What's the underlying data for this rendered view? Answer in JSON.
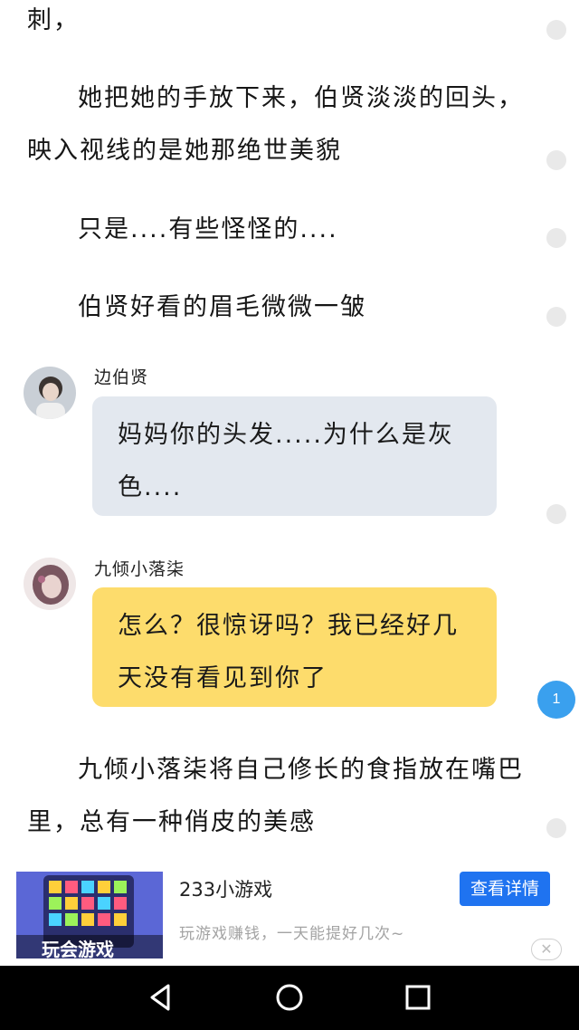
{
  "paragraphs": [
    "刺，",
    "她把她的手放下来，伯贤淡淡的回头，映入视线的是她那绝世美貌",
    "只是....有些怪怪的....",
    "伯贤好看的眉毛微微一皱",
    "九倾小落柒将自己修长的食指放在嘴巴里，总有一种俏皮的美感"
  ],
  "dialogs": [
    {
      "speaker": "边伯贤",
      "text": "妈妈你的头发.....为什么是灰色....",
      "bubble_color": "#e3e8ef"
    },
    {
      "speaker": "九倾小落柒",
      "text": "怎么？很惊讶吗？我已经好几天没有看见到你了",
      "bubble_color": "#fddc6c"
    }
  ],
  "comment_badge": "1",
  "ad": {
    "title": "233小游戏",
    "subtitle": "玩游戏赚钱，一天能提好几次~",
    "button": "查看详情",
    "thumb_text": "玩会游戏",
    "close": "✕"
  },
  "nav": {
    "back": "back-icon",
    "home": "home-icon",
    "recents": "recents-icon"
  },
  "colors": {
    "accent": "#3aa0ee",
    "ad_button": "#1f73f0"
  }
}
